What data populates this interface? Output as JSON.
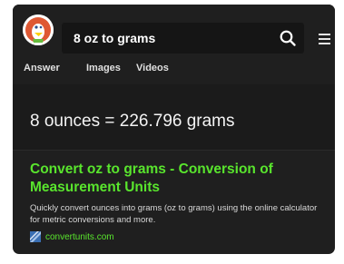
{
  "search": {
    "query": "8 oz to grams"
  },
  "tabs": [
    {
      "label": "Answer"
    },
    {
      "label": "Images"
    },
    {
      "label": "Videos"
    }
  ],
  "instant_answer": {
    "text": "8 ounces = 226.796 grams"
  },
  "results": [
    {
      "title": "Convert oz to grams - Conversion of Measurement Units",
      "snippet": "Quickly convert ounces into grams (oz to grams) using the online calculator for metric conversions and more.",
      "url": "convertunits.com"
    }
  ],
  "icons": {
    "logo": "duckduckgo-logo-icon",
    "search": "search-icon",
    "menu": "hamburger-menu-icon",
    "favicon": "convertunits-favicon-icon"
  },
  "colors": {
    "background": "#1f1f1f",
    "result_link": "#59e52d",
    "text": "#f4f4f4"
  }
}
